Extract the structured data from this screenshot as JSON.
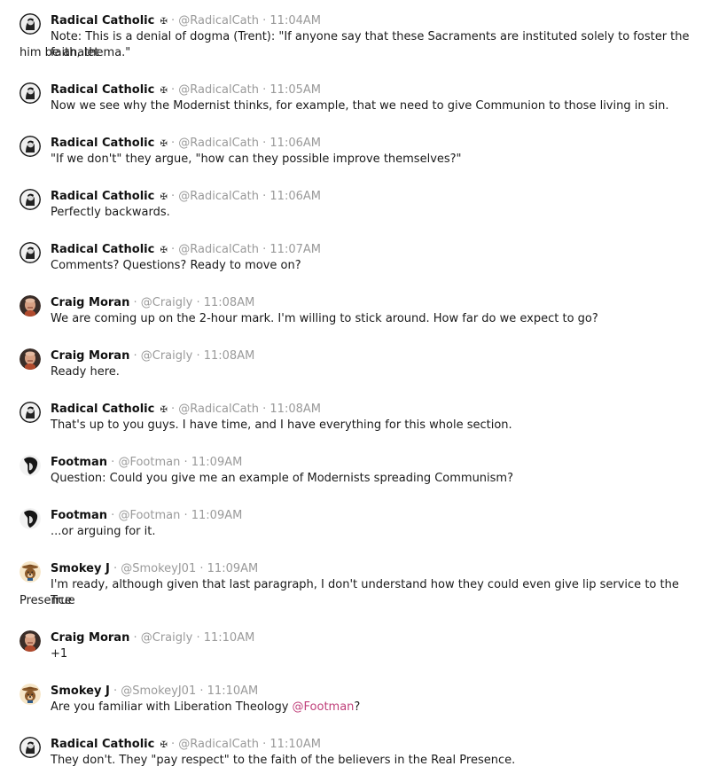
{
  "users": {
    "radical": {
      "name": "Radical Catholic",
      "badge": "✠",
      "handle": "@RadicalCath"
    },
    "craig": {
      "name": "Craig Moran",
      "handle": "@Craigly"
    },
    "footman": {
      "name": "Footman",
      "handle": "@Footman"
    },
    "smokey": {
      "name": "Smokey J",
      "handle": "@SmokeyJ01"
    }
  },
  "separator": "·",
  "messages": [
    {
      "time": "11:04AM",
      "text_line1": "Note: This is a denial of dogma (Trent): \"If anyone say that these Sacraments are instituted solely to foster the faith, let",
      "text_line2": "him be anathema.\""
    },
    {
      "time": "11:05AM",
      "text": "Now we see why the Modernist thinks, for example, that we need to give Communion to those living in sin."
    },
    {
      "time": "11:06AM",
      "text": "\"If we don't\" they argue, \"how can they possible improve themselves?\""
    },
    {
      "time": "11:06AM",
      "text": "Perfectly backwards."
    },
    {
      "time": "11:07AM",
      "text": "Comments? Questions? Ready to move on?"
    },
    {
      "time": "11:08AM",
      "text": "We are coming up on the 2-hour mark. I'm willing to stick around. How far do we expect to go?"
    },
    {
      "time": "11:08AM",
      "text": "Ready here."
    },
    {
      "time": "11:08AM",
      "text": "That's up to you guys. I have time, and I have everything for this whole section."
    },
    {
      "time": "11:09AM",
      "text": "Question: Could you give me an example of Modernists spreading Communism?"
    },
    {
      "time": "11:09AM",
      "text": "...or arguing for it."
    },
    {
      "time": "11:09AM",
      "text_line1": "I'm ready, although given that last paragraph, I don't understand how they could even give lip service to the True",
      "text_line2": "Presence"
    },
    {
      "time": "11:10AM",
      "text": "+1"
    },
    {
      "time": "11:10AM",
      "text": "Are you familiar with Liberation Theology ",
      "mention": "@Footman",
      "text_after": "?"
    },
    {
      "time": "11:10AM",
      "text": "They don't. They \"pay respect\" to the faith of the believers in the Real Presence."
    }
  ],
  "colors": {
    "mention": "#c0407a",
    "meta": "#9a9a9a"
  }
}
